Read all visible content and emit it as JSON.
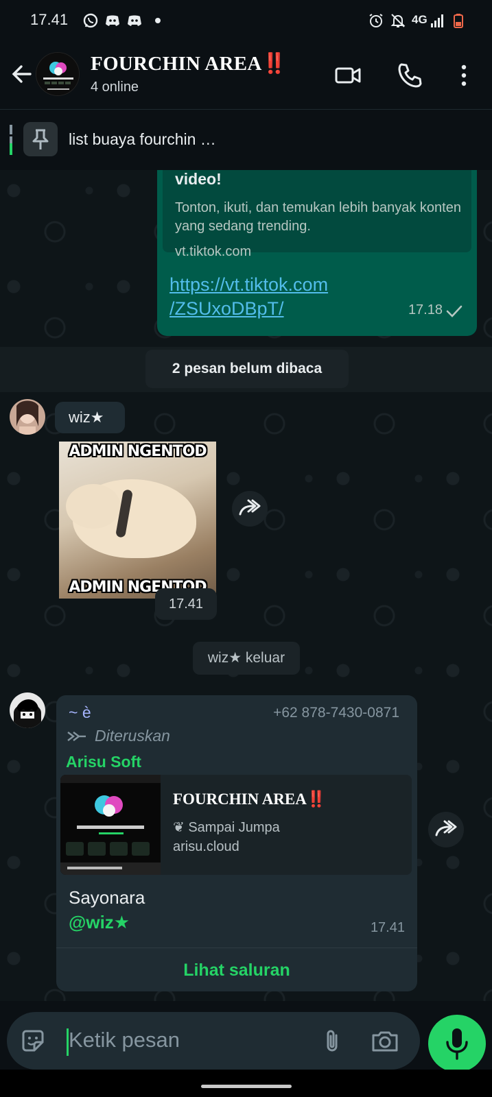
{
  "status_bar": {
    "time": "17.41",
    "network": "4G",
    "icons": [
      "whatsapp-icon",
      "discord-icon",
      "discord-icon",
      "dot-icon",
      "alarm-icon",
      "bell-off-icon",
      "signal-icon",
      "battery-low-icon"
    ]
  },
  "header": {
    "group_name": "FOURCHIN AREA",
    "group_name_suffix": "‼️",
    "subtitle": "4 online",
    "icons": [
      "back-arrow-icon",
      "video-call-icon",
      "phone-call-icon",
      "more-options-icon"
    ]
  },
  "pinned": {
    "text": "list buaya fourchin …",
    "icon": "pin-icon"
  },
  "messages": {
    "outgoing_link": {
      "preview_title": "video!",
      "preview_description": "Tonton, ikuti, dan temukan lebih banyak konten yang sedang trending.",
      "preview_host": "vt.tiktok.com",
      "link_line1": "https://vt.tiktok.com",
      "link_line2": "/ZSUxoDBpT/",
      "time": "17.18"
    },
    "unread_banner": "2 pesan belum dibaca",
    "sticker_message": {
      "sender": "wiz★",
      "caption_top": "ADMIN NGENTOD",
      "caption_bottom": "ADMIN NGENTOD",
      "time": "17.41"
    },
    "system_notice": "wiz★ keluar",
    "forwarded_message": {
      "sender_name": "~ è",
      "sender_phone": "+62 878-7430-0871",
      "forwarded_label": "Diteruskan",
      "source": "Arisu Soft",
      "card_title": "FOURCHIN AREA",
      "card_title_suffix": "‼️",
      "card_subtitle": "Sampai Jumpa",
      "card_subtitle_emoji": "❦",
      "card_host": "arisu.cloud",
      "text": "Sayonara",
      "mention": "@wiz★",
      "time": "17.41",
      "action": "Lihat saluran"
    }
  },
  "composer": {
    "placeholder": "Ketik pesan",
    "icons": [
      "sticker-icon",
      "attach-icon",
      "camera-icon",
      "mic-icon"
    ]
  },
  "colors": {
    "accent": "#25d366",
    "outgoing_bubble": "#005c4b",
    "incoming_bubble": "#1f2c33",
    "link": "#53bdeb",
    "background": "#0b1014"
  }
}
